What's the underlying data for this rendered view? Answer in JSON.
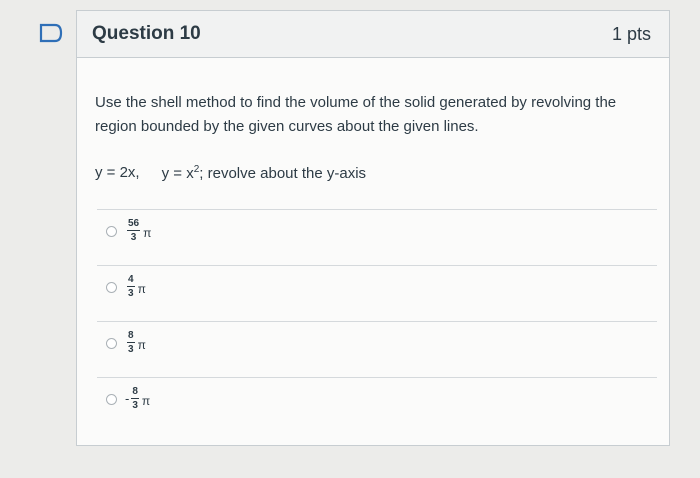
{
  "question": {
    "title": "Question 10",
    "points": "1 pts",
    "prompt": "Use the shell method to find the volume of the solid generated by revolving the region bounded by the given curves about the given lines.",
    "equation_1": "y = 2x,",
    "equation_2_prefix": "y = x",
    "equation_2_exp": "2",
    "equation_2_suffix": "; revolve about the y-axis"
  },
  "answers": [
    {
      "sign": "",
      "numerator": "56",
      "denominator": "3",
      "symbol": "π"
    },
    {
      "sign": "",
      "numerator": "4",
      "denominator": "3",
      "symbol": "π"
    },
    {
      "sign": "",
      "numerator": "8",
      "denominator": "3",
      "symbol": "π"
    },
    {
      "sign": "-",
      "numerator": "8",
      "denominator": "3",
      "symbol": "π"
    }
  ],
  "icons": {
    "flag": "flag-icon",
    "radio": "radio-button-icon"
  },
  "colors": {
    "flag_stroke": "#2f6fb7",
    "text": "#2d3b45"
  }
}
